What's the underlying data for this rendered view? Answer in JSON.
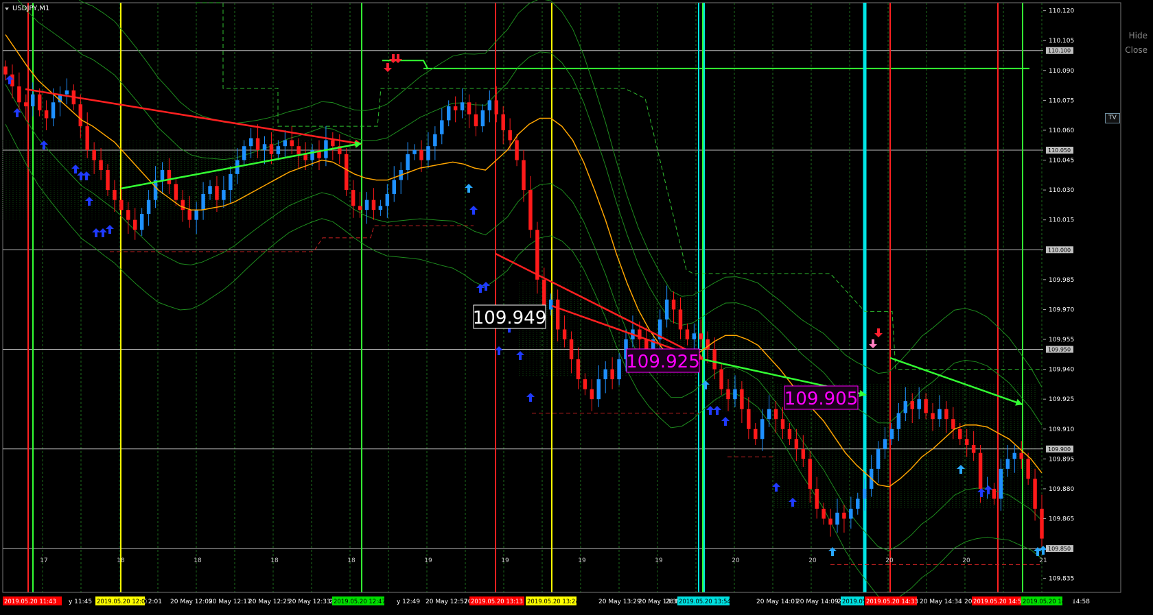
{
  "symbol": "USDJPY,M1",
  "overlay": {
    "hide_label": "Hide",
    "close_label": "Close",
    "tv_label": "TV"
  },
  "price_axis": {
    "ticks": [
      "110.120",
      "110.105",
      "110.090",
      "110.075",
      "110.060",
      "110.045",
      "110.030",
      "110.015",
      "109.985",
      "109.970",
      "109.955",
      "109.940",
      "109.925",
      "109.910",
      "109.895",
      "109.880",
      "109.865",
      "109.835"
    ],
    "level_labels": [
      "110.100",
      "110.050",
      "110.000",
      "109.950",
      "109.900",
      "109.850"
    ]
  },
  "price_labels": [
    {
      "text": "109.949",
      "color": "#ffffff"
    },
    {
      "text": "109.925",
      "color": "#ff00ff"
    },
    {
      "text": "109.905",
      "color": "#ff00ff"
    }
  ],
  "day_markers": [
    "17",
    "18",
    "18",
    "18",
    "18",
    "19",
    "19",
    "19",
    "19",
    "20",
    "20",
    "20",
    "20",
    "21"
  ],
  "time_axis": {
    "plain": [
      "y 11:45",
      "20 M",
      "12:01",
      "20 May 12:09",
      "20 May 12:17",
      "20 May 12:25",
      "20 May 12:33",
      "20 M",
      "y 12:49",
      "20 May 12:57",
      "20 Ma",
      "3:",
      "20 May 13:29",
      "20 May 13:37",
      "20 M",
      "53",
      "20 May 14:01",
      "20 May 14:09",
      "20 Ma",
      "20 May 14:34",
      "20 May 1",
      "14:58"
    ],
    "tags": [
      {
        "text": "2019.05.20 11:43",
        "color": "#ff0000"
      },
      {
        "text": "2019.05.20 12:00",
        "color": "#ffff00"
      },
      {
        "text": "2019.05.20 12:47",
        "color": "#00e000"
      },
      {
        "text": "2019.05.20 13:13",
        "color": "#ff0000"
      },
      {
        "text": "2019.05.20 13:24",
        "color": "#ffff00"
      },
      {
        "text": "2019.05.20 13:54",
        "color": "#00e0e0"
      },
      {
        "text": "2019.05.",
        "color": "#00e0e0"
      },
      {
        "text": "2019.05.20 14:33",
        "color": "#ff0000"
      },
      {
        "text": "2019.05.20 14:51",
        "color": "#ff0000"
      },
      {
        "text": "2019.05.20 14:57",
        "color": "#00e000"
      }
    ]
  },
  "colors": {
    "bull": "#1e90ff",
    "bear": "#ff1a1a",
    "ma": "#ffa500",
    "band": "#1e8c1e",
    "red_line": "#ff2020",
    "green_line": "#33ff33",
    "cyan_line": "#00e5e5",
    "yellow_line": "#ffff00",
    "grid": "#555555",
    "axis_text": "#ffffff"
  },
  "chart_data": {
    "type": "candlestick",
    "symbol": "USDJPY",
    "timeframe": "M1",
    "ylim": [
      109.828,
      110.124
    ],
    "horizontal_levels": [
      110.1,
      110.05,
      110.0,
      109.95,
      109.9,
      109.85
    ],
    "close": [
      110.088,
      110.082,
      110.074,
      110.072,
      110.078,
      110.07,
      110.066,
      110.074,
      110.078,
      110.08,
      110.073,
      110.062,
      110.05,
      110.045,
      110.04,
      110.03,
      110.025,
      110.02,
      110.015,
      110.01,
      110.018,
      110.025,
      110.035,
      110.04,
      110.033,
      110.025,
      110.02,
      110.015,
      110.02,
      110.028,
      110.032,
      110.025,
      110.03,
      110.038,
      110.045,
      110.052,
      110.056,
      110.05,
      110.053,
      110.048,
      110.052,
      110.055,
      110.052,
      110.048,
      110.045,
      110.05,
      110.046,
      110.055,
      110.052,
      110.048,
      110.03,
      110.022,
      110.02,
      110.025,
      110.02,
      110.022,
      110.028,
      110.035,
      110.04,
      110.048,
      110.05,
      110.045,
      110.052,
      110.058,
      110.065,
      110.072,
      110.07,
      110.074,
      110.068,
      110.062,
      110.07,
      110.075,
      110.068,
      110.06,
      110.055,
      110.045,
      110.03,
      110.01,
      109.985,
      109.97,
      109.975,
      109.96,
      109.955,
      109.945,
      109.935,
      109.93,
      109.925,
      109.935,
      109.94,
      109.935,
      109.945,
      109.955,
      109.96,
      109.955,
      109.95,
      109.955,
      109.965,
      109.975,
      109.97,
      109.96,
      109.955,
      109.958,
      109.955,
      109.95,
      109.94,
      109.93,
      109.925,
      109.93,
      109.92,
      109.91,
      109.905,
      109.915,
      109.92,
      109.915,
      109.91,
      109.905,
      109.9,
      109.895,
      109.88,
      109.87,
      109.865,
      109.862,
      109.868,
      109.865,
      109.87,
      109.875,
      109.88,
      109.89,
      109.9,
      109.905,
      109.91,
      109.918,
      109.924,
      109.92,
      109.925,
      109.918,
      109.915,
      109.92,
      109.915,
      109.91,
      109.905,
      109.902,
      109.898,
      109.88,
      109.88,
      109.875,
      109.89,
      109.895,
      109.898,
      109.895,
      109.885,
      109.87,
      109.855
    ],
    "series": [
      {
        "name": "MA",
        "values": [
          110.108,
          110.1,
          110.092,
          110.085,
          110.08,
          110.075,
          110.07,
          110.065,
          110.062,
          110.058,
          110.054,
          110.048,
          110.042,
          110.036,
          110.03,
          110.026,
          110.022,
          110.02,
          110.02,
          110.021,
          110.022,
          110.024,
          110.027,
          110.03,
          110.033,
          110.036,
          110.039,
          110.041,
          110.043,
          110.045,
          110.044,
          110.041,
          110.038,
          110.036,
          110.035,
          110.035,
          110.037,
          110.039,
          110.041,
          110.042,
          110.043,
          110.044,
          110.043,
          110.041,
          110.04,
          110.045,
          110.05,
          110.058,
          110.063,
          110.066,
          110.066,
          110.062,
          110.055,
          110.044,
          110.03,
          110.015,
          109.998,
          109.983,
          109.97,
          109.96,
          109.952,
          109.945,
          109.944,
          109.946,
          109.95,
          109.954,
          109.957,
          109.957,
          109.955,
          109.952,
          109.946,
          109.94,
          109.933,
          109.926,
          109.92,
          109.914,
          109.906,
          109.898,
          109.892,
          109.887,
          109.882,
          109.881,
          109.885,
          109.89,
          109.896,
          109.9,
          109.905,
          109.91,
          109.912,
          109.912,
          109.911,
          109.908,
          109.905,
          109.9,
          109.895,
          109.888
        ]
      }
    ]
  }
}
